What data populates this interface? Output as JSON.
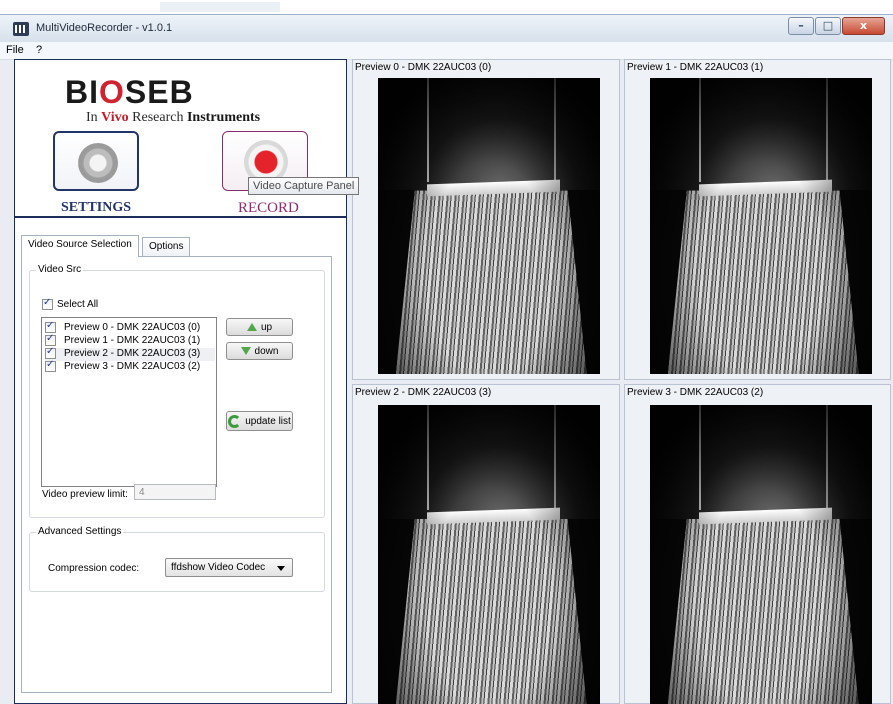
{
  "window": {
    "title": "MultiVideoRecorder - v1.0.1",
    "controls": {
      "minimize": "–",
      "maximize": "□",
      "close": "x"
    }
  },
  "menu": {
    "file": "File",
    "help": "?"
  },
  "logo": {
    "main_left": "BI",
    "main_o": "O",
    "main_right": "SEB",
    "sub_in": "In ",
    "sub_vivo": "Vivo",
    "sub_research": " Research ",
    "sub_instruments": "Instruments"
  },
  "buttons": {
    "settings_label": "SETTINGS",
    "record_label": "RECORD",
    "record_tooltip": "Video Capture Panel"
  },
  "tabs": [
    {
      "label": "Video Source Selection",
      "active": true
    },
    {
      "label": "Options",
      "active": false
    }
  ],
  "video_src": {
    "group_title": "Video Src",
    "select_all": "Select All",
    "sources": [
      {
        "label": "Preview 0 - DMK 22AUC03 (0)",
        "checked": true
      },
      {
        "label": "Preview 1 - DMK 22AUC03 (1)",
        "checked": true
      },
      {
        "label": "Preview 2 - DMK 22AUC03 (3)",
        "checked": true,
        "selected": true
      },
      {
        "label": "Preview 3 - DMK 22AUC03 (2)",
        "checked": true
      }
    ],
    "up_button": "up",
    "down_button": "down",
    "update_button": "update list",
    "preview_limit_label": "Video preview limit:",
    "preview_limit_value": "4"
  },
  "advanced": {
    "group_title": "Advanced Settings",
    "codec_label": "Compression codec:",
    "codec_value": "ffdshow Video Codec"
  },
  "previews": [
    {
      "title": "Preview 0 - DMK 22AUC03 (0)"
    },
    {
      "title": "Preview 1 - DMK 22AUC03 (1)"
    },
    {
      "title": "Preview 2 - DMK 22AUC03 (3)"
    },
    {
      "title": "Preview 3 - DMK 22AUC03 (2)"
    }
  ],
  "colors": {
    "panel_border": "#1d2d5a",
    "settings_text": "#243468",
    "record_text": "#8d2a72",
    "record_dot": "#e4232b",
    "logo_red": "#d0232f"
  },
  "icons": [
    "app-icon",
    "gear-icon",
    "record-icon",
    "up-arrow-icon",
    "down-arrow-icon",
    "refresh-icon",
    "dropdown-arrow-icon"
  ]
}
